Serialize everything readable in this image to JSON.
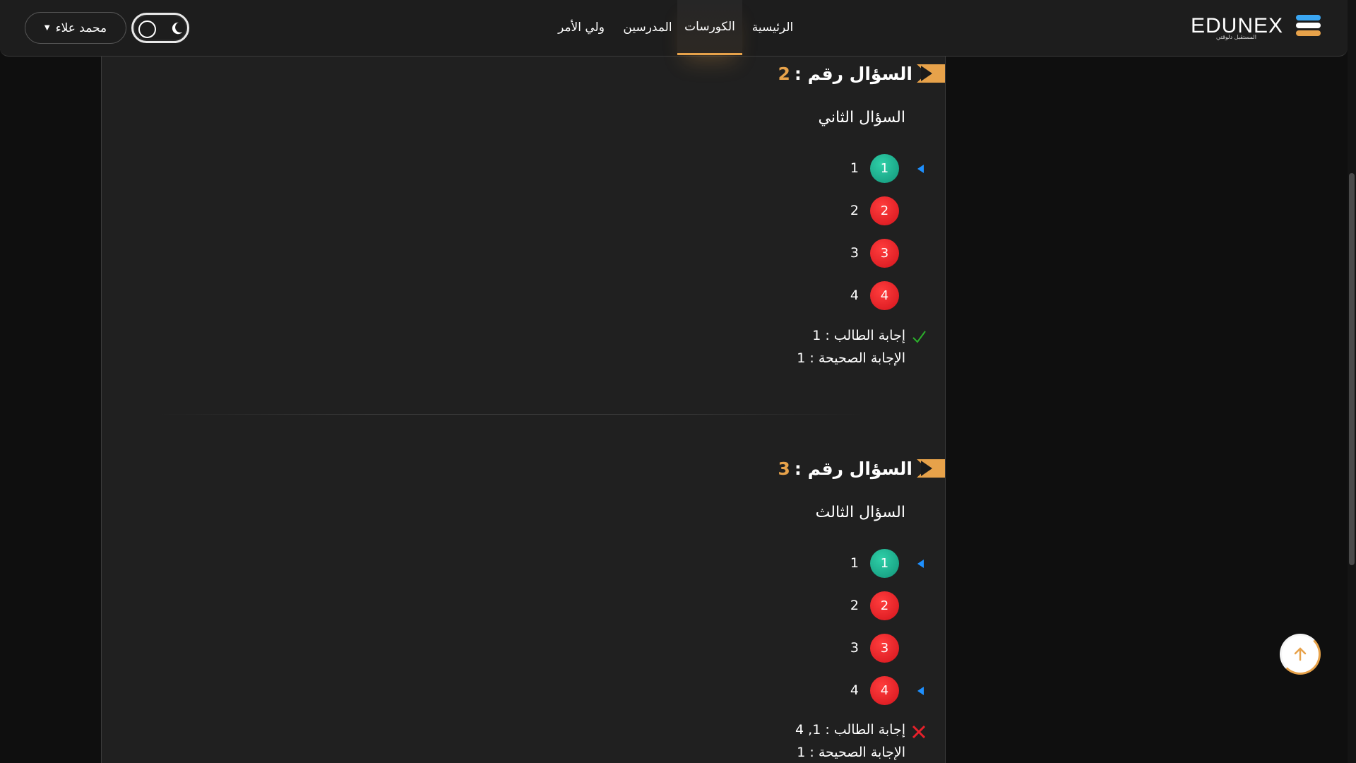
{
  "nav": {
    "user_name": "محمد علاء",
    "links": [
      "الرئيسية",
      "الكورسات",
      "المدرسين",
      "ولي الأمر"
    ],
    "active": "الكورسات",
    "logo_text": "EDUNEX",
    "logo_tagline": "المستقبل دلوقتي"
  },
  "questions": [
    {
      "heading": "السؤال رقم :",
      "number": "2",
      "text": "السؤال الثاني",
      "options": [
        {
          "badge": "1",
          "label": "1",
          "status": "correct",
          "selected": true
        },
        {
          "badge": "2",
          "label": "2",
          "status": "wrong",
          "selected": false
        },
        {
          "badge": "3",
          "label": "3",
          "status": "wrong",
          "selected": false
        },
        {
          "badge": "4",
          "label": "4",
          "status": "wrong",
          "selected": false
        }
      ],
      "student_answer": "إجابة الطالب : 1",
      "correct_answer": "الإجابة الصحيحة : 1",
      "result": "correct"
    },
    {
      "heading": "السؤال رقم :",
      "number": "3",
      "text": "السؤال الثالث",
      "options": [
        {
          "badge": "1",
          "label": "1",
          "status": "correct",
          "selected": true
        },
        {
          "badge": "2",
          "label": "2",
          "status": "wrong",
          "selected": false
        },
        {
          "badge": "3",
          "label": "3",
          "status": "wrong",
          "selected": false
        },
        {
          "badge": "4",
          "label": "4",
          "status": "wrong",
          "selected": true
        }
      ],
      "student_answer": "إجابة الطالب : 1, 4",
      "correct_answer": "الإجابة الصحيحة : 1",
      "result": "wrong"
    }
  ],
  "colors": {
    "accent": "#e7a24a",
    "correct": "#1fb493",
    "wrong": "#e8202a",
    "marker": "#1e90ff",
    "check": "#2bb02b",
    "cross": "#e8202a"
  }
}
